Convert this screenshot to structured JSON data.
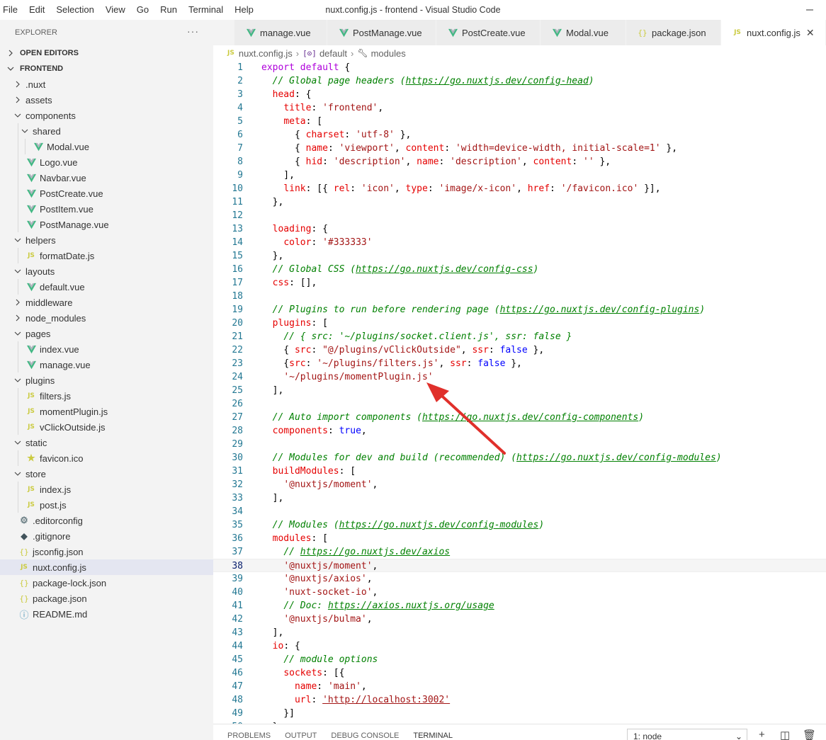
{
  "window": {
    "title": "nuxt.config.js - frontend - Visual Studio Code",
    "menu": [
      "File",
      "Edit",
      "Selection",
      "View",
      "Go",
      "Run",
      "Terminal",
      "Help"
    ]
  },
  "sidebar": {
    "title": "EXPLORER",
    "more": "···",
    "open_editors": "OPEN EDITORS",
    "project": "FRONTEND",
    "tree": [
      {
        "label": ".nuxt",
        "type": "folder",
        "depth": 1,
        "open": false
      },
      {
        "label": "assets",
        "type": "folder",
        "depth": 1,
        "open": false
      },
      {
        "label": "components",
        "type": "folder",
        "depth": 1,
        "open": true
      },
      {
        "label": "shared",
        "type": "folder",
        "depth": 2,
        "open": true
      },
      {
        "label": "Modal.vue",
        "type": "vue",
        "depth": 3
      },
      {
        "label": "Logo.vue",
        "type": "vue",
        "depth": 2
      },
      {
        "label": "Navbar.vue",
        "type": "vue",
        "depth": 2
      },
      {
        "label": "PostCreate.vue",
        "type": "vue",
        "depth": 2
      },
      {
        "label": "PostItem.vue",
        "type": "vue",
        "depth": 2
      },
      {
        "label": "PostManage.vue",
        "type": "vue",
        "depth": 2
      },
      {
        "label": "helpers",
        "type": "folder",
        "depth": 1,
        "open": true
      },
      {
        "label": "formatDate.js",
        "type": "js",
        "depth": 2
      },
      {
        "label": "layouts",
        "type": "folder",
        "depth": 1,
        "open": true
      },
      {
        "label": "default.vue",
        "type": "vue",
        "depth": 2
      },
      {
        "label": "middleware",
        "type": "folder",
        "depth": 1,
        "open": false
      },
      {
        "label": "node_modules",
        "type": "folder",
        "depth": 1,
        "open": false
      },
      {
        "label": "pages",
        "type": "folder",
        "depth": 1,
        "open": true
      },
      {
        "label": "index.vue",
        "type": "vue",
        "depth": 2
      },
      {
        "label": "manage.vue",
        "type": "vue",
        "depth": 2
      },
      {
        "label": "plugins",
        "type": "folder",
        "depth": 1,
        "open": true
      },
      {
        "label": "filters.js",
        "type": "js",
        "depth": 2
      },
      {
        "label": "momentPlugin.js",
        "type": "js",
        "depth": 2
      },
      {
        "label": "vClickOutside.js",
        "type": "js",
        "depth": 2
      },
      {
        "label": "static",
        "type": "folder",
        "depth": 1,
        "open": true
      },
      {
        "label": "favicon.ico",
        "type": "star",
        "depth": 2
      },
      {
        "label": "store",
        "type": "folder",
        "depth": 1,
        "open": true
      },
      {
        "label": "index.js",
        "type": "js",
        "depth": 2
      },
      {
        "label": "post.js",
        "type": "js",
        "depth": 2
      },
      {
        "label": ".editorconfig",
        "type": "gear",
        "depth": 1
      },
      {
        "label": ".gitignore",
        "type": "git",
        "depth": 1
      },
      {
        "label": "jsconfig.json",
        "type": "json",
        "depth": 1
      },
      {
        "label": "nuxt.config.js",
        "type": "js",
        "depth": 1,
        "selected": true
      },
      {
        "label": "package-lock.json",
        "type": "json",
        "depth": 1
      },
      {
        "label": "package.json",
        "type": "json",
        "depth": 1
      },
      {
        "label": "README.md",
        "type": "info",
        "depth": 1
      }
    ]
  },
  "tabs": [
    {
      "label": "manage.vue",
      "type": "vue",
      "width": 131
    },
    {
      "label": "PostManage.vue",
      "type": "vue",
      "width": 154
    },
    {
      "label": "PostCreate.vue",
      "type": "vue",
      "width": 147
    },
    {
      "label": "Modal.vue",
      "type": "vue",
      "width": 121
    },
    {
      "label": "package.json",
      "type": "json",
      "width": 134
    },
    {
      "label": "nuxt.config.js",
      "type": "js",
      "active": true,
      "width": 148
    }
  ],
  "breadcrumb": {
    "file": "nuxt.config.js",
    "symbol": "default",
    "property": "modules"
  },
  "editor": {
    "current_line": 38,
    "lines": [
      [
        [
          "kw",
          "export"
        ],
        [
          "p",
          " "
        ],
        [
          "kw",
          "default"
        ],
        [
          "p",
          " {"
        ]
      ],
      [
        [
          "p",
          "  "
        ],
        [
          "cmt",
          "// Global page headers ("
        ],
        [
          "cmtu",
          "https://go.nuxtjs.dev/config-head"
        ],
        [
          "cmt",
          ")"
        ]
      ],
      [
        [
          "p",
          "  "
        ],
        [
          "key",
          "head"
        ],
        [
          "p",
          ": {"
        ]
      ],
      [
        [
          "p",
          "    "
        ],
        [
          "key",
          "title"
        ],
        [
          "p",
          ": "
        ],
        [
          "str",
          "'frontend'"
        ],
        [
          "p",
          ","
        ]
      ],
      [
        [
          "p",
          "    "
        ],
        [
          "key",
          "meta"
        ],
        [
          "p",
          ": ["
        ]
      ],
      [
        [
          "p",
          "      { "
        ],
        [
          "key",
          "charset"
        ],
        [
          "p",
          ": "
        ],
        [
          "str",
          "'utf-8'"
        ],
        [
          "p",
          " },"
        ]
      ],
      [
        [
          "p",
          "      { "
        ],
        [
          "key",
          "name"
        ],
        [
          "p",
          ": "
        ],
        [
          "str",
          "'viewport'"
        ],
        [
          "p",
          ", "
        ],
        [
          "key",
          "content"
        ],
        [
          "p",
          ": "
        ],
        [
          "str",
          "'width=device-width, initial-scale=1'"
        ],
        [
          "p",
          " },"
        ]
      ],
      [
        [
          "p",
          "      { "
        ],
        [
          "key",
          "hid"
        ],
        [
          "p",
          ": "
        ],
        [
          "str",
          "'description'"
        ],
        [
          "p",
          ", "
        ],
        [
          "key",
          "name"
        ],
        [
          "p",
          ": "
        ],
        [
          "str",
          "'description'"
        ],
        [
          "p",
          ", "
        ],
        [
          "key",
          "content"
        ],
        [
          "p",
          ": "
        ],
        [
          "str",
          "''"
        ],
        [
          "p",
          " },"
        ]
      ],
      [
        [
          "p",
          "    ],"
        ]
      ],
      [
        [
          "p",
          "    "
        ],
        [
          "key",
          "link"
        ],
        [
          "p",
          ": [{ "
        ],
        [
          "key",
          "rel"
        ],
        [
          "p",
          ": "
        ],
        [
          "str",
          "'icon'"
        ],
        [
          "p",
          ", "
        ],
        [
          "key",
          "type"
        ],
        [
          "p",
          ": "
        ],
        [
          "str",
          "'image/x-icon'"
        ],
        [
          "p",
          ", "
        ],
        [
          "key",
          "href"
        ],
        [
          "p",
          ": "
        ],
        [
          "str",
          "'/favicon.ico'"
        ],
        [
          "p",
          " }],"
        ]
      ],
      [
        [
          "p",
          "  },"
        ]
      ],
      [
        [
          "p",
          ""
        ]
      ],
      [
        [
          "p",
          "  "
        ],
        [
          "key",
          "loading"
        ],
        [
          "p",
          ": {"
        ]
      ],
      [
        [
          "p",
          "    "
        ],
        [
          "key",
          "color"
        ],
        [
          "p",
          ": "
        ],
        [
          "str",
          "'#333333'"
        ]
      ],
      [
        [
          "p",
          "  },"
        ]
      ],
      [
        [
          "p",
          "  "
        ],
        [
          "cmt",
          "// Global CSS ("
        ],
        [
          "cmtu",
          "https://go.nuxtjs.dev/config-css"
        ],
        [
          "cmt",
          ")"
        ]
      ],
      [
        [
          "p",
          "  "
        ],
        [
          "key",
          "css"
        ],
        [
          "p",
          ": [],"
        ]
      ],
      [
        [
          "p",
          ""
        ]
      ],
      [
        [
          "p",
          "  "
        ],
        [
          "cmt",
          "// Plugins to run before rendering page ("
        ],
        [
          "cmtu",
          "https://go.nuxtjs.dev/config-plugins"
        ],
        [
          "cmt",
          ")"
        ]
      ],
      [
        [
          "p",
          "  "
        ],
        [
          "key",
          "plugins"
        ],
        [
          "p",
          ": ["
        ]
      ],
      [
        [
          "p",
          "    "
        ],
        [
          "cmt",
          "// { src: '~/plugins/socket.client.js', ssr: false }"
        ]
      ],
      [
        [
          "p",
          "    { "
        ],
        [
          "key",
          "src"
        ],
        [
          "p",
          ": "
        ],
        [
          "str",
          "\"@/plugins/vClickOutside\""
        ],
        [
          "p",
          ", "
        ],
        [
          "key",
          "ssr"
        ],
        [
          "p",
          ": "
        ],
        [
          "lit",
          "false"
        ],
        [
          "p",
          " },"
        ]
      ],
      [
        [
          "p",
          "    {"
        ],
        [
          "key",
          "src"
        ],
        [
          "p",
          ": "
        ],
        [
          "str",
          "'~/plugins/filters.js'"
        ],
        [
          "p",
          ", "
        ],
        [
          "key",
          "ssr"
        ],
        [
          "p",
          ": "
        ],
        [
          "lit",
          "false"
        ],
        [
          "p",
          " },"
        ]
      ],
      [
        [
          "p",
          "    "
        ],
        [
          "str",
          "'~/plugins/momentPlugin.js'"
        ]
      ],
      [
        [
          "p",
          "  ],"
        ]
      ],
      [
        [
          "p",
          ""
        ]
      ],
      [
        [
          "p",
          "  "
        ],
        [
          "cmt",
          "// Auto import components ("
        ],
        [
          "cmtu",
          "https://go.nuxtjs.dev/config-components"
        ],
        [
          "cmt",
          ")"
        ]
      ],
      [
        [
          "p",
          "  "
        ],
        [
          "key",
          "components"
        ],
        [
          "p",
          ": "
        ],
        [
          "lit",
          "true"
        ],
        [
          "p",
          ","
        ]
      ],
      [
        [
          "p",
          ""
        ]
      ],
      [
        [
          "p",
          "  "
        ],
        [
          "cmt",
          "// Modules for dev and build (recommended) ("
        ],
        [
          "cmtu",
          "https://go.nuxtjs.dev/config-modules"
        ],
        [
          "cmt",
          ")"
        ]
      ],
      [
        [
          "p",
          "  "
        ],
        [
          "key",
          "buildModules"
        ],
        [
          "p",
          ": ["
        ]
      ],
      [
        [
          "p",
          "    "
        ],
        [
          "str",
          "'@nuxtjs/moment'"
        ],
        [
          "p",
          ","
        ]
      ],
      [
        [
          "p",
          "  ],"
        ]
      ],
      [
        [
          "p",
          ""
        ]
      ],
      [
        [
          "p",
          "  "
        ],
        [
          "cmt",
          "// Modules ("
        ],
        [
          "cmtu",
          "https://go.nuxtjs.dev/config-modules"
        ],
        [
          "cmt",
          ")"
        ]
      ],
      [
        [
          "p",
          "  "
        ],
        [
          "key",
          "modules"
        ],
        [
          "p",
          ": ["
        ]
      ],
      [
        [
          "p",
          "    "
        ],
        [
          "cmt",
          "// "
        ],
        [
          "cmtu",
          "https://go.nuxtjs.dev/axios"
        ]
      ],
      [
        [
          "p",
          "    "
        ],
        [
          "str",
          "'@nuxtjs/moment'"
        ],
        [
          "p",
          ","
        ]
      ],
      [
        [
          "p",
          "    "
        ],
        [
          "str",
          "'@nuxtjs/axios'"
        ],
        [
          "p",
          ","
        ]
      ],
      [
        [
          "p",
          "    "
        ],
        [
          "str",
          "'nuxt-socket-io'"
        ],
        [
          "p",
          ","
        ]
      ],
      [
        [
          "p",
          "    "
        ],
        [
          "cmt",
          "// Doc: "
        ],
        [
          "cmtu",
          "https://axios.nuxtjs.org/usage"
        ]
      ],
      [
        [
          "p",
          "    "
        ],
        [
          "str",
          "'@nuxtjs/bulma'"
        ],
        [
          "p",
          ","
        ]
      ],
      [
        [
          "p",
          "  ],"
        ]
      ],
      [
        [
          "p",
          "  "
        ],
        [
          "key",
          "io"
        ],
        [
          "p",
          ": {"
        ]
      ],
      [
        [
          "p",
          "    "
        ],
        [
          "cmt",
          "// module options"
        ]
      ],
      [
        [
          "p",
          "    "
        ],
        [
          "key",
          "sockets"
        ],
        [
          "p",
          ": [{"
        ]
      ],
      [
        [
          "p",
          "      "
        ],
        [
          "key",
          "name"
        ],
        [
          "p",
          ": "
        ],
        [
          "str",
          "'main'"
        ],
        [
          "p",
          ","
        ]
      ],
      [
        [
          "p",
          "      "
        ],
        [
          "key",
          "url"
        ],
        [
          "p",
          ": "
        ],
        [
          "stru",
          "'http://localhost:3002'"
        ]
      ],
      [
        [
          "p",
          "    }]"
        ]
      ],
      [
        [
          "p",
          "  }"
        ]
      ]
    ]
  },
  "panel": {
    "tabs": [
      "PROBLEMS",
      "OUTPUT",
      "DEBUG CONSOLE",
      "TERMINAL"
    ],
    "active_tab": "TERMINAL",
    "terminal_select": "1: node"
  },
  "colors": {
    "vue": "#41b883",
    "js": "#cbcb41",
    "arrow": "#e0302b"
  }
}
